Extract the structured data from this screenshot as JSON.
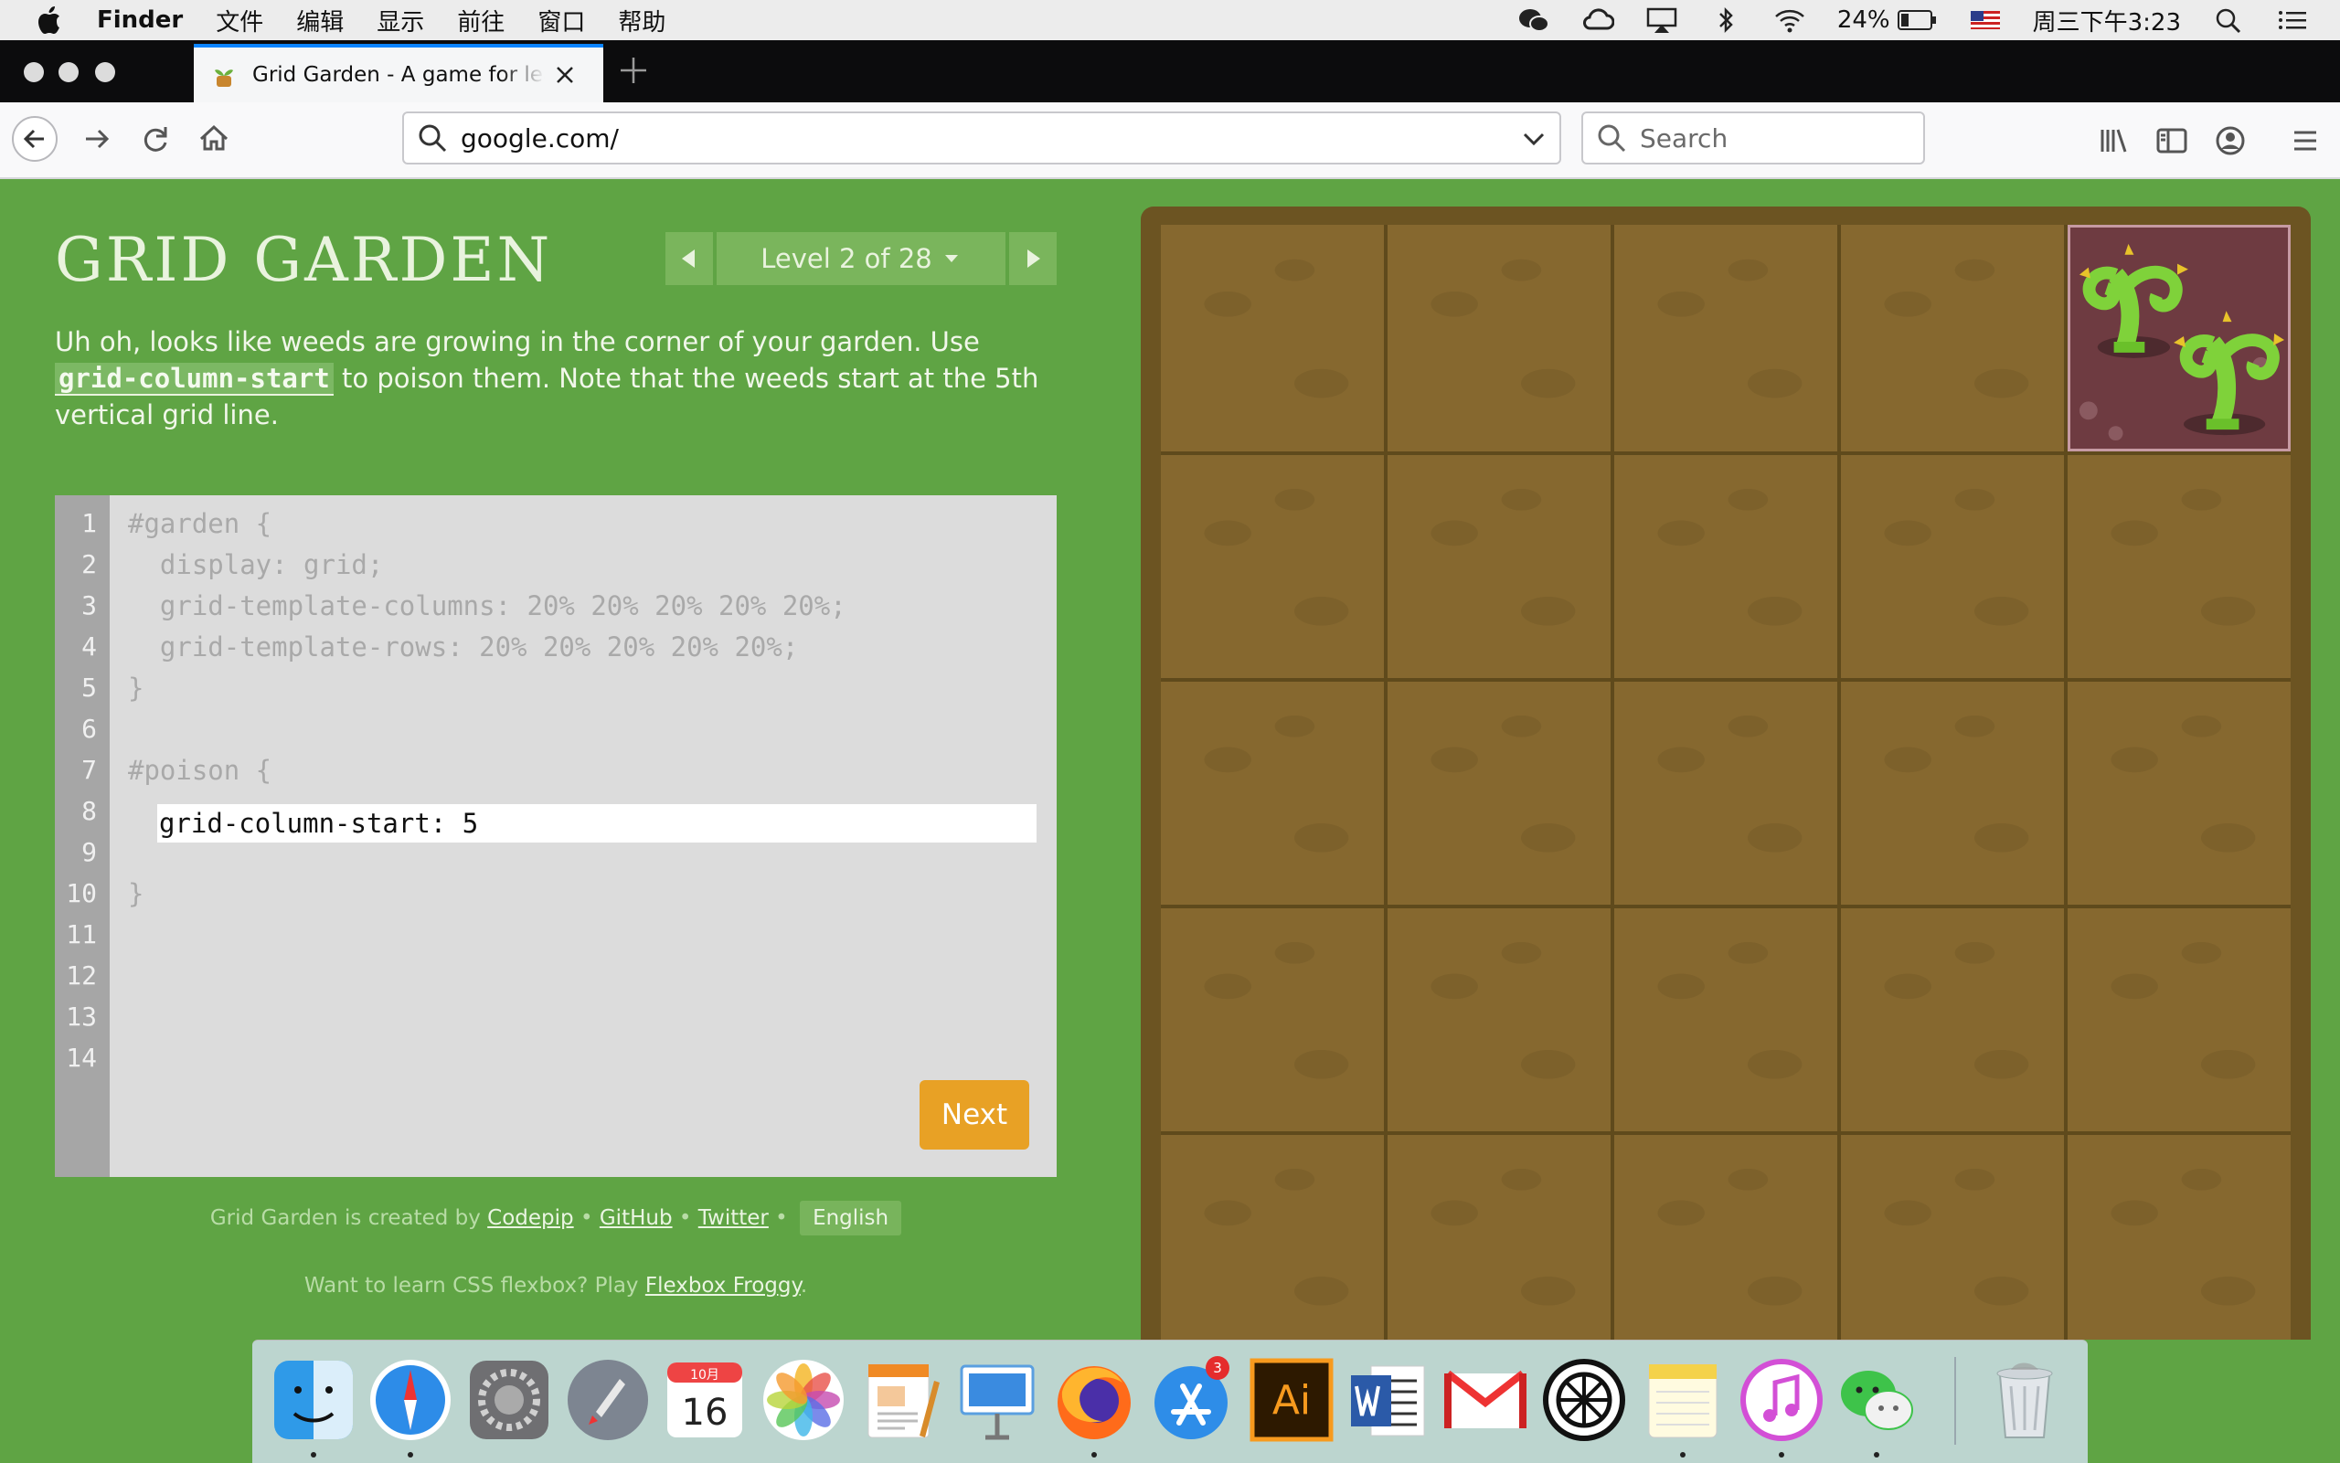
{
  "menubar": {
    "app_name": "Finder",
    "menus": [
      "文件",
      "编辑",
      "显示",
      "前往",
      "窗口",
      "帮助"
    ],
    "battery": "24%",
    "clock": "周三下午3:23"
  },
  "browser": {
    "tab_title": "Grid Garden - A game for learning CSS grid",
    "url": "google.com/",
    "search_placeholder": "Search"
  },
  "game": {
    "title": "GRID GARDEN",
    "level_label": "Level 2 of 28",
    "instructions_pre": "Uh oh, looks like weeds are growing in the corner of your garden. Use ",
    "instructions_code": "grid-column-start",
    "instructions_post": " to poison them. Note that the weeds start at the 5th vertical grid line.",
    "line_numbers": [
      "1",
      "2",
      "3",
      "4",
      "5",
      "6",
      "7",
      "8",
      "9",
      "10",
      "11",
      "12",
      "13",
      "14"
    ],
    "code": {
      "l1": "#garden {",
      "l2": "  display: grid;",
      "l3": "  grid-template-columns: 20% 20% 20% 20% 20%;",
      "l4": "  grid-template-rows: 20% 20% 20% 20% 20%;",
      "l5": "}",
      "l7": "#poison {",
      "l10": "}"
    },
    "input_value": "grid-column-start: 5",
    "next_label": "Next",
    "credits_prefix": "Grid Garden is created by ",
    "credits_codepip": "Codepip",
    "credits_github": "GitHub",
    "credits_twitter": "Twitter",
    "credits_language": "English",
    "promo_prefix": "Want to learn CSS flexbox? Play ",
    "promo_link": "Flexbox Froggy",
    "promo_suffix": "."
  },
  "dock": {
    "items": [
      "finder-icon",
      "safari-icon",
      "system-preferences-icon",
      "launchpad-icon",
      "calendar-icon",
      "photos-icon",
      "pages-icon",
      "keynote-icon",
      "firefox-icon",
      "app-store-icon",
      "illustrator-icon",
      "word-icon",
      "gmail-icon",
      "mask-app-icon",
      "notes-icon",
      "itunes-icon",
      "wechat-icon",
      "trash-icon"
    ],
    "calendar_month": "10月",
    "calendar_day": "16",
    "appstore_badge": "3",
    "illustrator_label": "Ai"
  },
  "colors": {
    "page_bg": "#5fa444",
    "soil": "#86682f",
    "poison": "#6e3b41",
    "next_button": "#e8a125",
    "tab_accent": "#0a84ff"
  }
}
